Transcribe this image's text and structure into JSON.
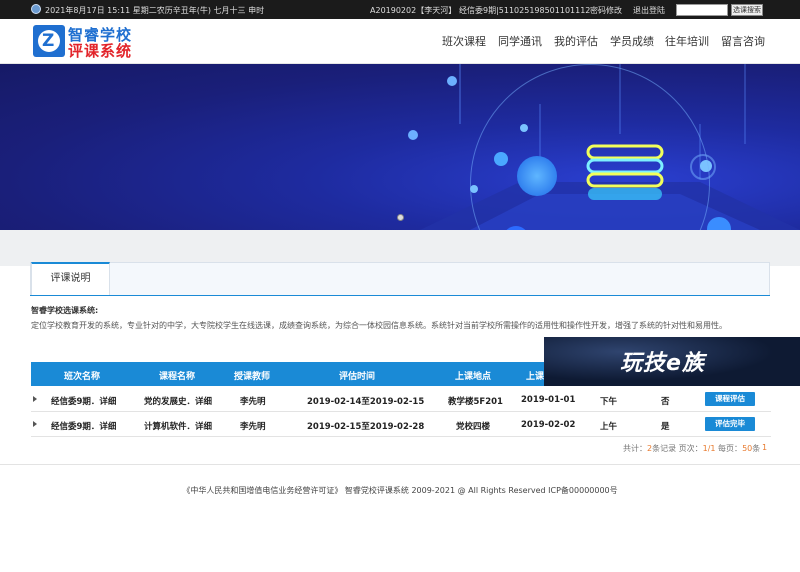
{
  "topbar": {
    "date": "2021年8月17日  15:11  星期二农历辛丑年(牛)  七月十三  申时",
    "user": "A20190202【李天河】",
    "class_info": "经信委9期|511025198501101112",
    "change_password": "密码修改",
    "logout": "退出登陆",
    "search_placeholder": "",
    "search_button": "选课搜索"
  },
  "logo": {
    "line1": "智睿学校",
    "line2": "评课系统"
  },
  "nav": [
    "班次课程",
    "同学通讯",
    "我的评估",
    "学员成绩",
    "往年培训",
    "留言咨询"
  ],
  "tabs": [
    "评课说明"
  ],
  "description": {
    "title": "智睿学校选课系统:",
    "text": "定位学校教育开发的系统，专业针对的中学，大专院校学生在线选课，成绩查询系统，为综合一体校园信息系统。系统针对当前学校所需操作的适用性和操作性开发，增强了系统的针对性和易用性。"
  },
  "table": {
    "headers": [
      "班次名称",
      "课程名称",
      "授课教师",
      "评估时间",
      "上课地点",
      "上课",
      "",
      "",
      ""
    ],
    "rows": [
      {
        "class": "经信委9期．详细",
        "course": "党的发展史．详细",
        "teacher": "李先明",
        "period": "2019-02-14至2019-02-15",
        "location": "教学楼5F201",
        "date": "2019-01-01",
        "time": "下午",
        "status": "否",
        "action": "课程评估"
      },
      {
        "class": "经信委9期．详细",
        "course": "计算机软件．详细",
        "teacher": "李先明",
        "period": "2019-02-15至2019-02-28",
        "location": "党校四楼",
        "date": "2019-02-02",
        "time": "上午",
        "status": "是",
        "action": "评估完毕"
      }
    ]
  },
  "pagination": {
    "total_label": "共计：",
    "total": "2",
    "records_label": "条记录 页次：",
    "page": "1/1",
    "per_page_label": " 每页：",
    "per_page": "50",
    "per_page_suffix": "条",
    "current": "1"
  },
  "footer": "《中华人民共和国增值电信业务经营许可证》 智睿党校评课系统 2009-2021 @ All Rights Reserved   ICP备00000000号",
  "watermark": "玩技e族",
  "colors": {
    "accent": "#1a8ad6",
    "banner": "#1e2ba0",
    "logo_blue": "#1f6fd0",
    "logo_red": "#e2242a"
  }
}
